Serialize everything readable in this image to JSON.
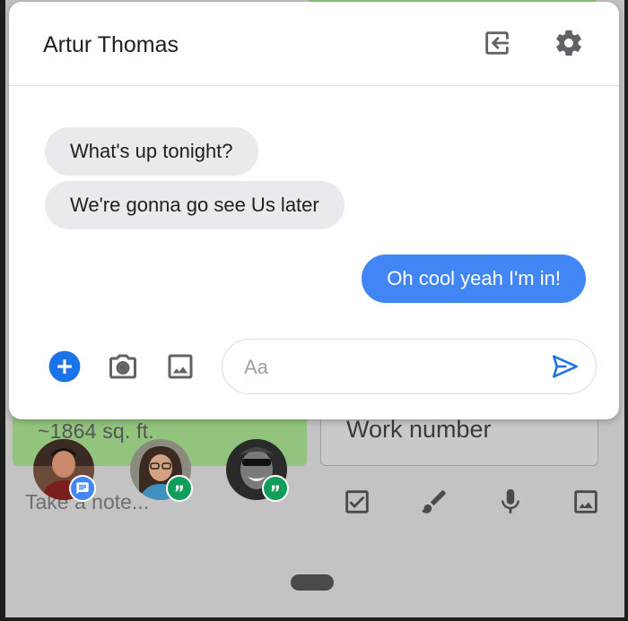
{
  "chat": {
    "title": "Artur Thomas",
    "header_icons": [
      "exit-to-app-icon",
      "gear-icon"
    ],
    "messages": [
      {
        "direction": "incoming",
        "text": "What's up tonight?"
      },
      {
        "direction": "incoming",
        "text": "We're gonna go see Us later"
      },
      {
        "direction": "outgoing",
        "text": "Oh cool yeah I'm in!"
      }
    ],
    "composer": {
      "placeholder": "Aa",
      "value": "",
      "icons": [
        "add-circle-icon",
        "camera-icon",
        "image-icon",
        "send-icon"
      ]
    },
    "colors": {
      "accent": "#4285f4",
      "incoming_bubble": "#e8eaed",
      "outgoing_bubble": "#4285f4"
    }
  },
  "background": {
    "notes": [
      {
        "text": "~1864 sq. ft.",
        "color": "#93c47d"
      },
      {
        "text": "Work number",
        "color": "#c9c9c9"
      }
    ],
    "take_note_placeholder": "Take a note...",
    "bottom_icons": [
      "checkbox-icon",
      "brush-icon",
      "microphone-icon",
      "image-icon"
    ]
  },
  "chat_heads": [
    {
      "name": "avatar-man-messages",
      "badge": "messages-icon",
      "badge_color": "#4285f4"
    },
    {
      "name": "avatar-woman-hangouts",
      "badge": "hangouts-icon",
      "badge_color": "#0f9d58"
    },
    {
      "name": "avatar-grayscale-hangouts",
      "badge": "hangouts-icon",
      "badge_color": "#0f9d58"
    }
  ]
}
